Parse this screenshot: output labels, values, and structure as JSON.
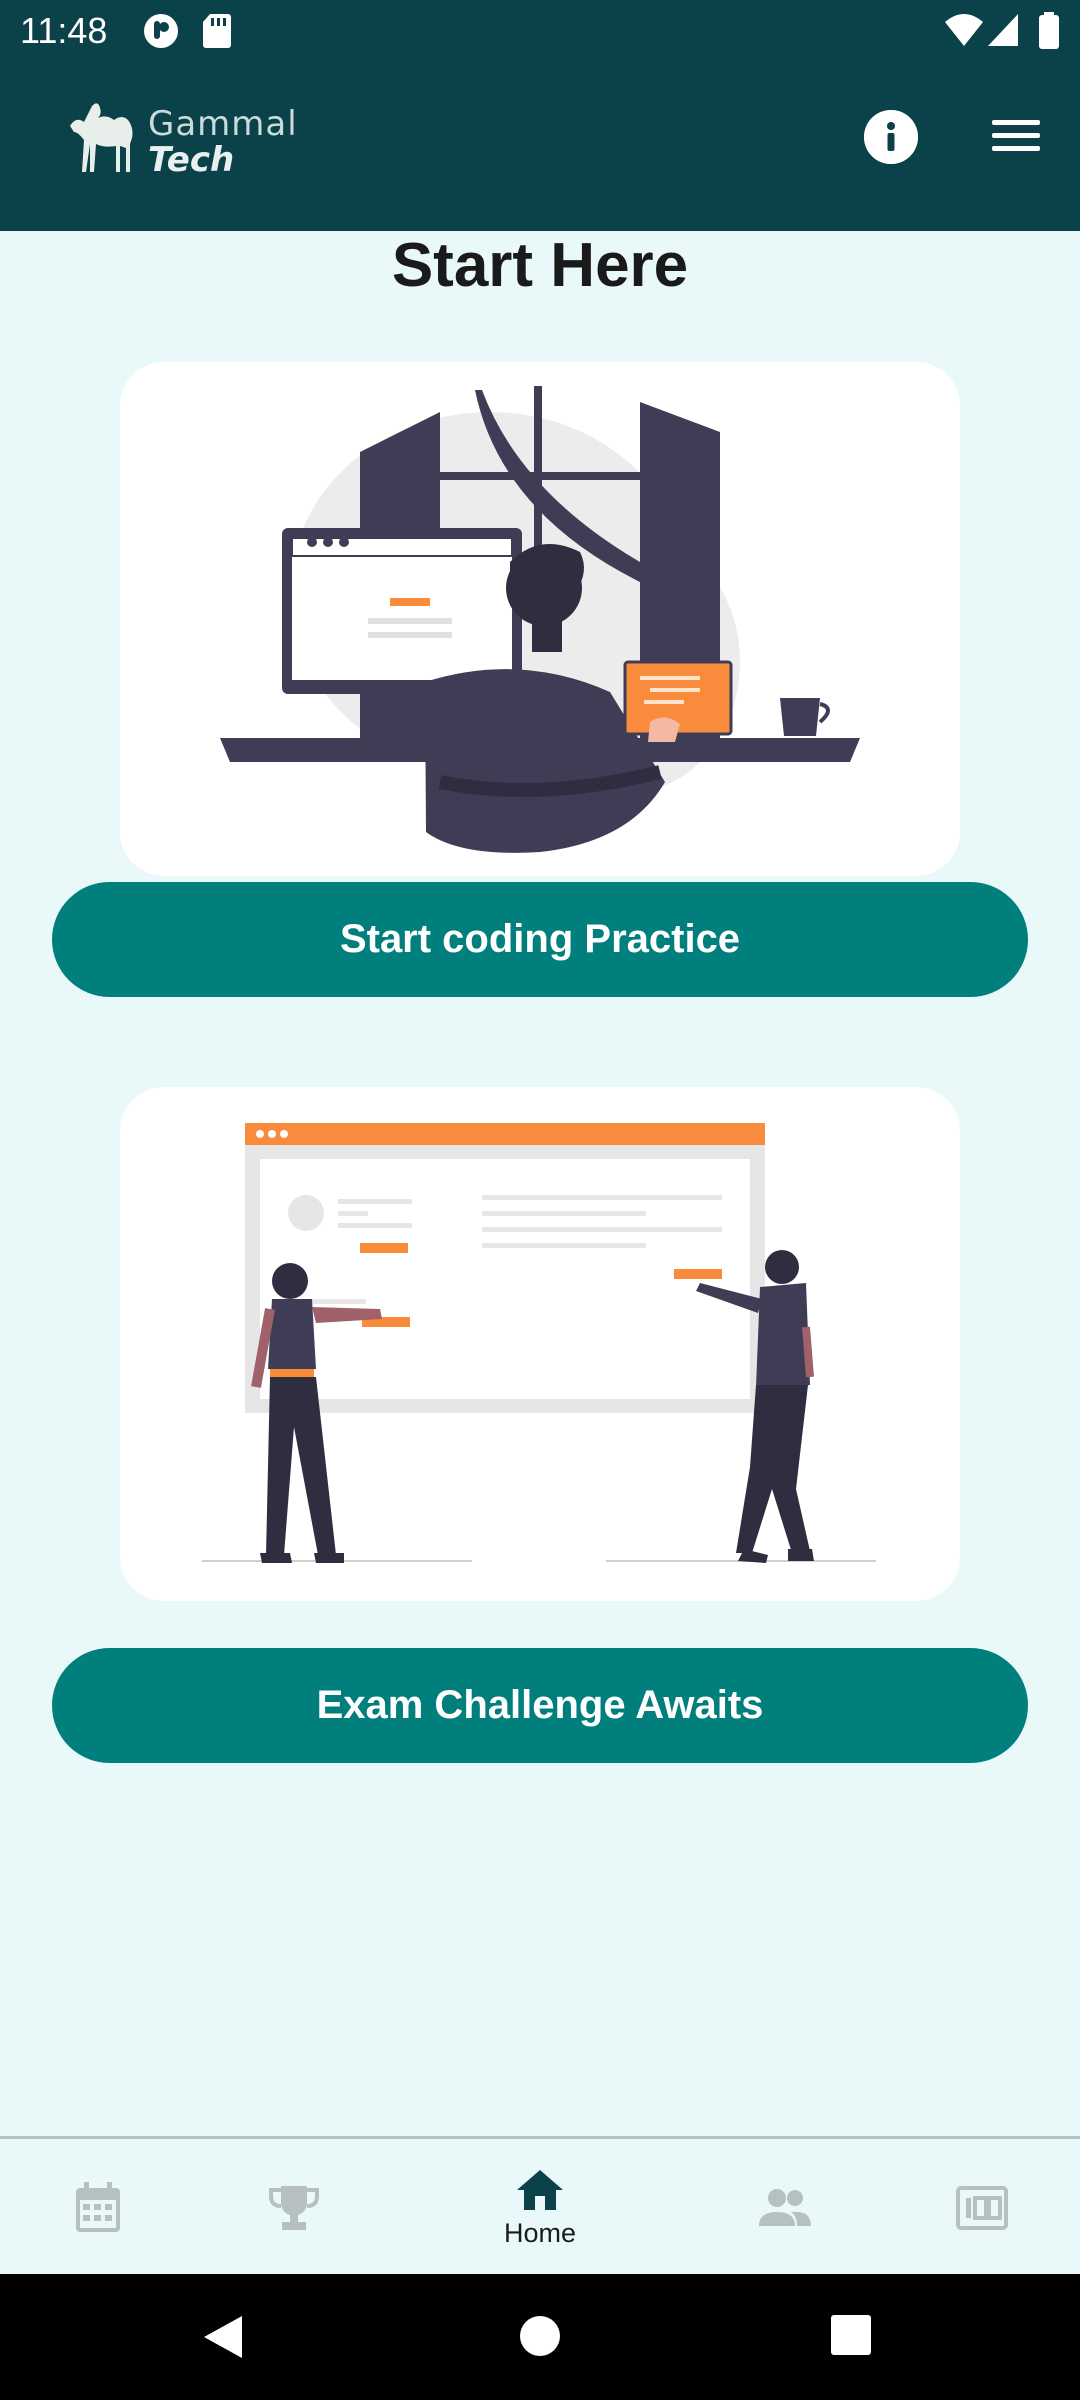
{
  "status_bar": {
    "time": "11:48"
  },
  "app_bar": {
    "logo_line1": "Gammal",
    "logo_line2": "Tech",
    "info_icon": "info-icon",
    "menu_icon": "hamburger-menu-icon"
  },
  "main": {
    "title": "Start Here",
    "cards": [
      {
        "illustration": "person-coding-at-desk",
        "button_label": "Start coding Practice"
      },
      {
        "illustration": "two-people-at-whiteboard",
        "button_label": "Exam Challenge Awaits"
      }
    ]
  },
  "bottom_nav": {
    "items": [
      {
        "icon": "calendar-icon",
        "label": ""
      },
      {
        "icon": "trophy-icon",
        "label": ""
      },
      {
        "icon": "home-icon",
        "label": "Home",
        "selected": true
      },
      {
        "icon": "people-icon",
        "label": ""
      },
      {
        "icon": "score-100-icon",
        "label": ""
      }
    ]
  },
  "colors": {
    "app_bar": "#0b4148",
    "background": "#e9f9f9",
    "button": "#017f7c",
    "accent_orange": "#f98c3c",
    "illustration_dark": "#3f3d56"
  }
}
